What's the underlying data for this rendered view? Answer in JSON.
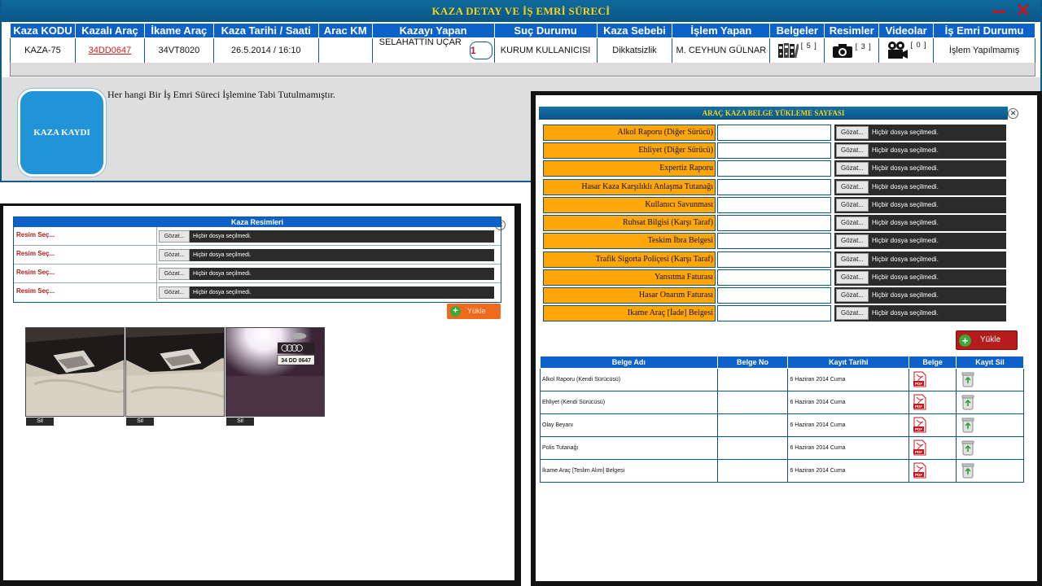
{
  "main_window": {
    "title": "KAZA DETAY VE İŞ EMRİ SÜRECİ",
    "columns": [
      "Kaza KODU",
      "Kazalı Araç",
      "İkame Araç",
      "Kaza Tarihi / Saati",
      "Arac KM",
      "Kazayı Yapan",
      "Suç Durumu",
      "Kaza Sebebi",
      "İşlem Yapan",
      "Belgeler",
      "Resimler",
      "Videolar",
      "İş Emri Durumu"
    ],
    "row": {
      "kaza_kodu": "KAZA-75",
      "kazali_arac": "34DD0647",
      "ikame_arac": "34VT8020",
      "tarih": "26.5.2014 / 16:10",
      "arac_km": "",
      "kazayi_yapan": "SELAHATTİN UÇAR",
      "kazayi_yapan_badge": "1",
      "suc_durumu": "KURUM KULLANICISI",
      "kaza_sebebi": "Dikkatsizlik",
      "islem_yapan": "M. CEYHUN GÜLNAR",
      "belgeler_count": "[ 5 ]",
      "resimler_count": "[ 3 ]",
      "videolar_count": "[ 0 ]",
      "is_emri_durumu": "İşlem Yapılmamış"
    },
    "kaza_kaydi_button": "KAZA KAYDI",
    "no_workorder_text": "Her hangi Bir İş Emri Süreci İşlemine Tabi Tutulmamıştır."
  },
  "resimler_popup": {
    "header": "Kaza Resimleri",
    "rows": [
      {
        "label": "Resim Seç...",
        "button": "Gözat...",
        "status": "Hiçbir dosya seçilmedi."
      },
      {
        "label": "Resim Seç...",
        "button": "Gözat...",
        "status": "Hiçbir dosya seçilmedi."
      },
      {
        "label": "Resim Seç...",
        "button": "Gözat...",
        "status": "Hiçbir dosya seçilmedi."
      },
      {
        "label": "Resim Seç...",
        "button": "Gözat...",
        "status": "Hiçbir dosya seçilmedi."
      }
    ],
    "upload_button": "Yükle",
    "delete_label": "Sil",
    "plate_text": "34 DD 0647"
  },
  "belge_popup": {
    "title": "ARAÇ KAZA BELGE YÜKLEME SAYFASI",
    "rows": [
      {
        "label": "Alkol Raporu (Diğer Sürücü)"
      },
      {
        "label": "Ehliyet (Diğer Sürücü)"
      },
      {
        "label": "Expertiz Raporu"
      },
      {
        "label": "Hasar Kaza Karşılıklı Anlaşma Tutanağı"
      },
      {
        "label": "Kullanıcı Savunması"
      },
      {
        "label": "Ruhsat Bilgisi (Karşı Taraf)"
      },
      {
        "label": "Teskim İbra Belgesi"
      },
      {
        "label": "Trafik Sigorta Poliçesi (Karşı Taraf)"
      },
      {
        "label": "Yansıtma Faturası"
      },
      {
        "label": "Hasar Onarım Faturası"
      },
      {
        "label": "Ikame Araç [İade] Belgesi"
      }
    ],
    "browse_button": "Gözat...",
    "no_file_text": "Hiçbir dosya seçilmedi.",
    "upload_button": "Yükle",
    "table_headers": [
      "Belge Adı",
      "Belge No",
      "Kayıt Tarihi",
      "Belge",
      "Kayıt Sil"
    ],
    "documents": [
      {
        "name": "Alkol Raporu (Kendi Sürücüsü)",
        "no": "",
        "date": "6 Haziran 2014 Cuma"
      },
      {
        "name": "Ehliyet (Kendi Sürücüsü)",
        "no": "",
        "date": "6 Haziran 2014 Cuma"
      },
      {
        "name": "Olay Beyanı",
        "no": "",
        "date": "6 Haziran 2014 Cuma"
      },
      {
        "name": "Polis Tutanağı",
        "no": "",
        "date": "6 Haziran 2014 Cuma"
      },
      {
        "name": "İkame Araç [Teslim Alım] Belgesi",
        "no": "",
        "date": "6 Haziran 2014 Cuma"
      }
    ],
    "pdf_label": "PDF"
  }
}
